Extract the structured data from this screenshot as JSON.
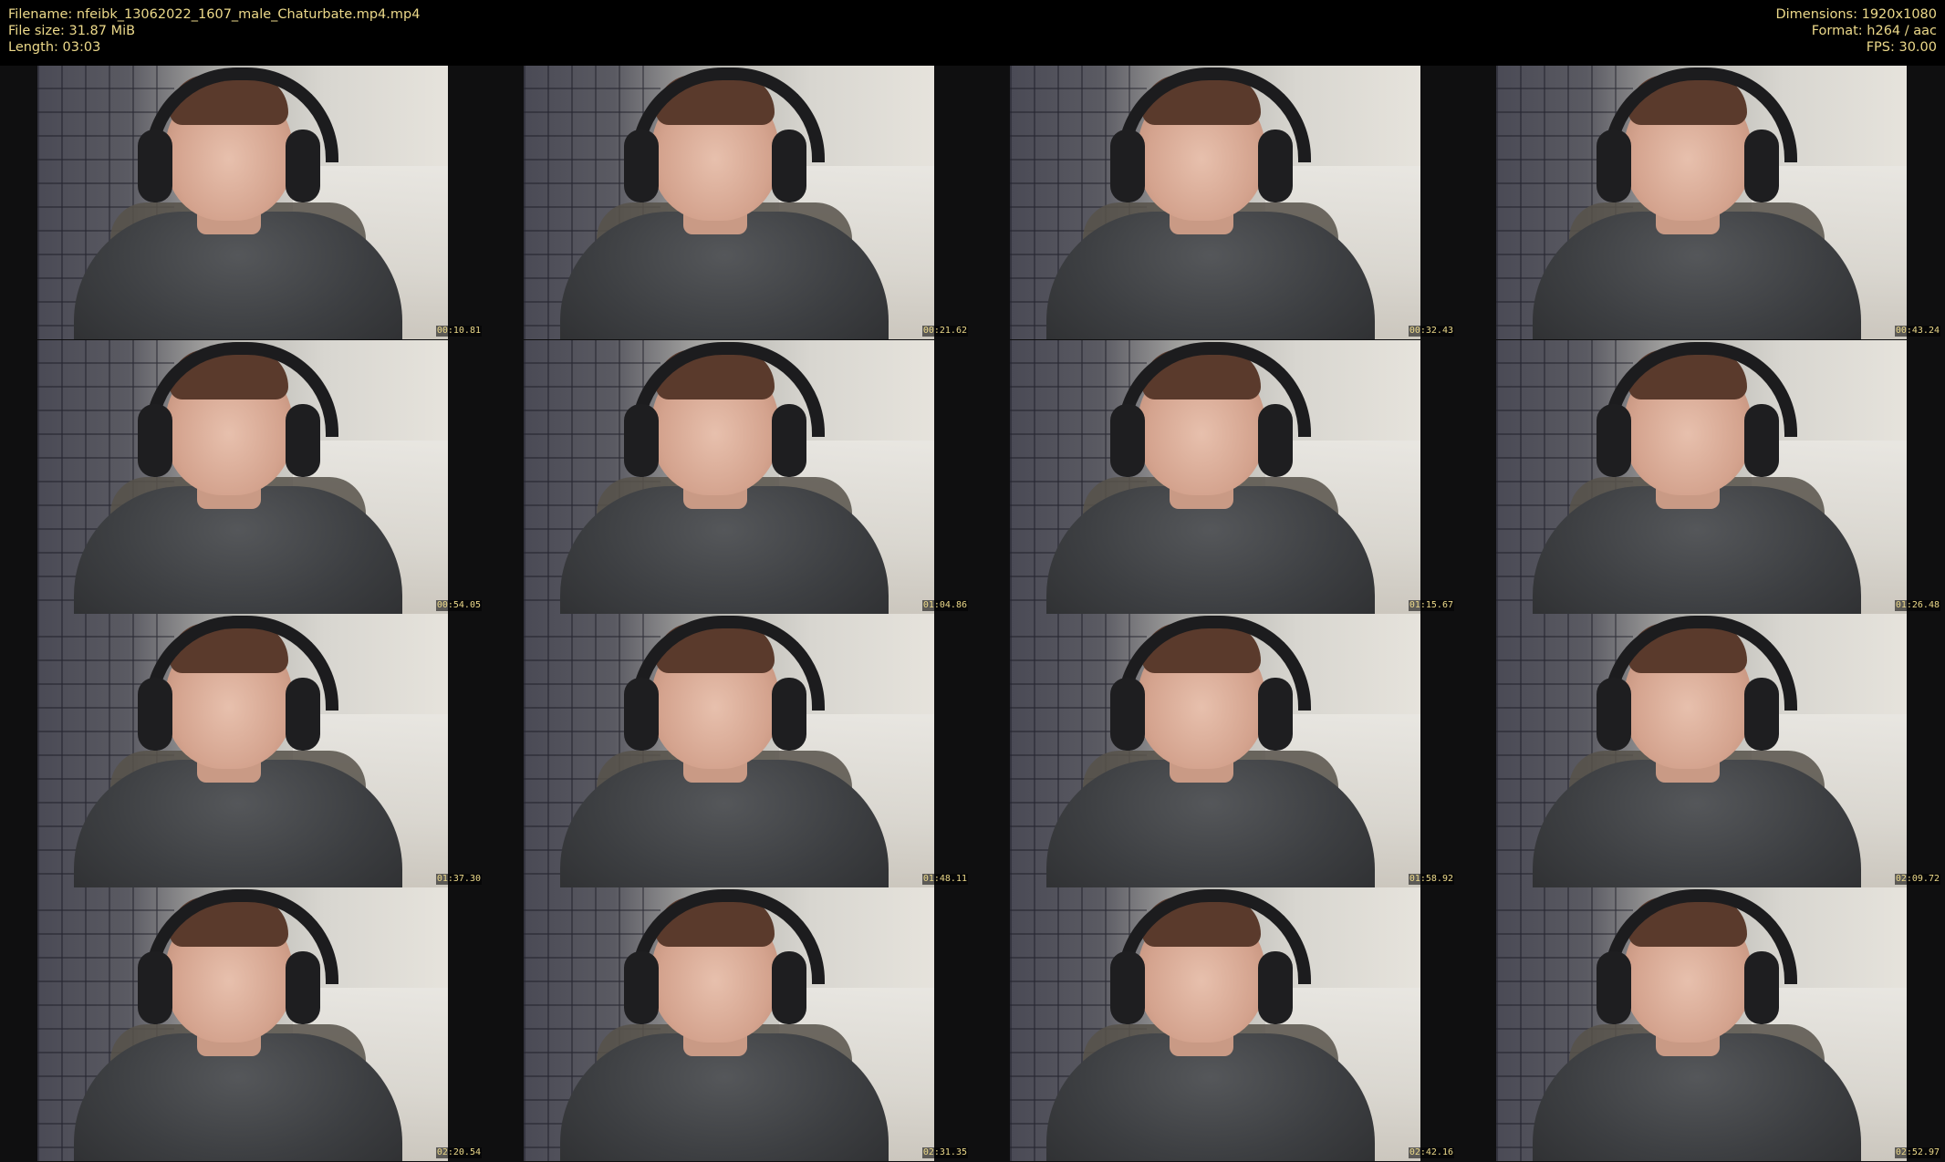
{
  "header": {
    "left": [
      "Filename: nfeibk_13062022_1607_male_Chaturbate.mp4.mp4",
      "File size: 31.87 MiB",
      "Length: 03:03"
    ],
    "right": [
      "Dimensions: 1920x1080",
      "Format: h264 / aac",
      "FPS: 30.00"
    ]
  },
  "thumbnails": [
    {
      "timestamp": "00:10.81"
    },
    {
      "timestamp": "00:21.62"
    },
    {
      "timestamp": "00:32.43"
    },
    {
      "timestamp": "00:43.24"
    },
    {
      "timestamp": "00:54.05"
    },
    {
      "timestamp": "01:04.86"
    },
    {
      "timestamp": "01:15.67"
    },
    {
      "timestamp": "01:26.48"
    },
    {
      "timestamp": "01:37.30"
    },
    {
      "timestamp": "01:48.11"
    },
    {
      "timestamp": "01:58.92"
    },
    {
      "timestamp": "02:09.72"
    },
    {
      "timestamp": "02:20.54"
    },
    {
      "timestamp": "02:31.35"
    },
    {
      "timestamp": "02:42.16"
    },
    {
      "timestamp": "02:52.97"
    }
  ],
  "colors": {
    "text": "#ecd98a",
    "background": "#000000"
  }
}
